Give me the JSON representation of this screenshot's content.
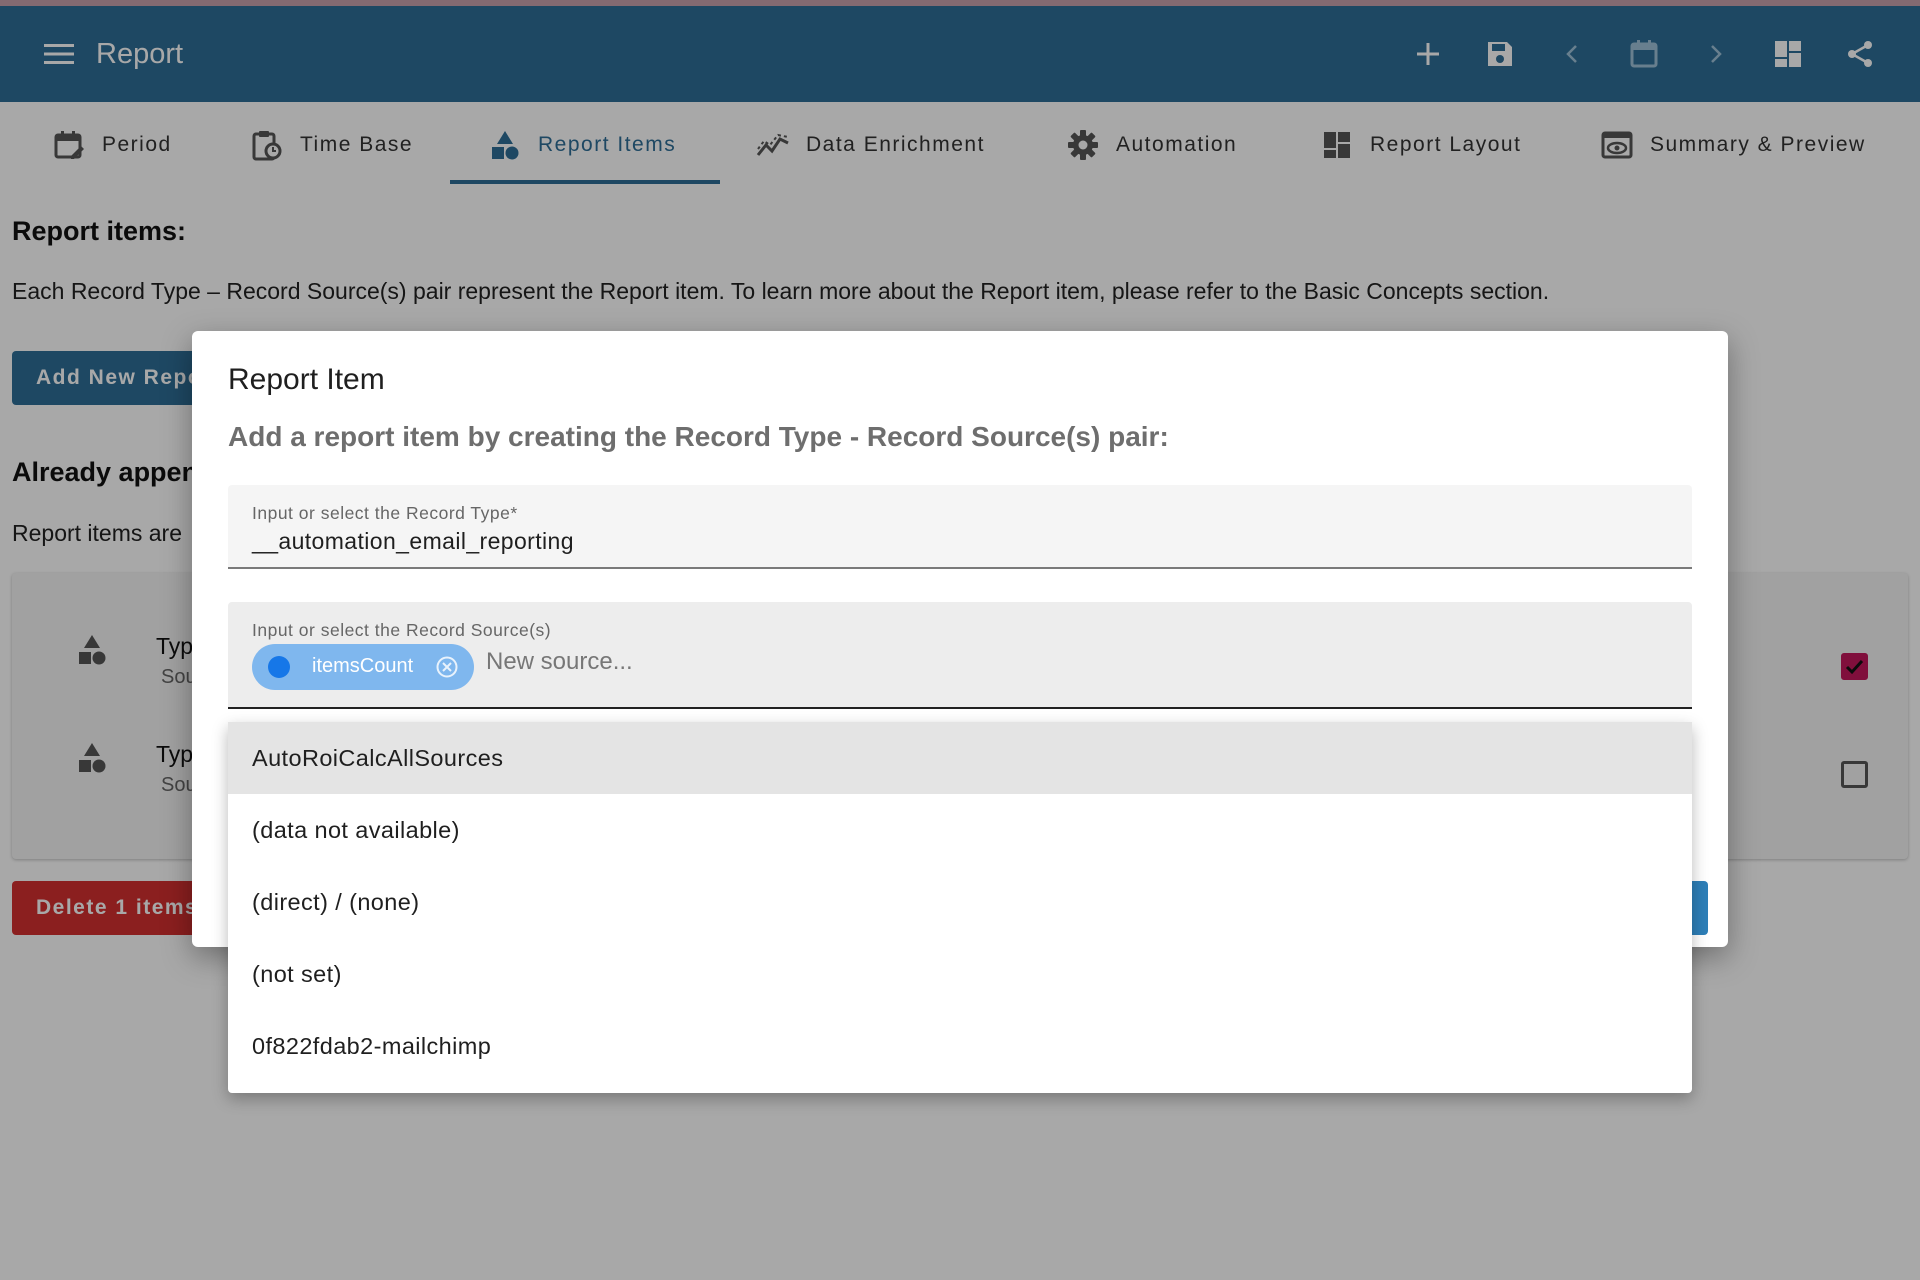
{
  "appbar": {
    "title": "Report",
    "actions": [
      "add-icon",
      "save-icon",
      "chevron-left-icon",
      "calendar-icon",
      "chevron-right-icon",
      "dashboard-icon",
      "share-icon"
    ]
  },
  "tabs": [
    {
      "label": "Period",
      "icon": "calendar-edit-icon"
    },
    {
      "label": "Time Base",
      "icon": "clipboard-clock-icon"
    },
    {
      "label": "Report Items",
      "icon": "shapes-icon",
      "active": true
    },
    {
      "label": "Data Enrichment",
      "icon": "chart-line-icon"
    },
    {
      "label": "Automation",
      "icon": "gear-icon"
    },
    {
      "label": "Report Layout",
      "icon": "dashboard-icon"
    },
    {
      "label": "Summary & Preview",
      "icon": "eye-preview-icon"
    }
  ],
  "content": {
    "heading": "Report items:",
    "description": "Each Record Type – Record Source(s) pair represent the Report item. To learn more about the Report item, please refer to the Basic Concepts section.",
    "add_button": "Add New Repo",
    "appended_heading": "Already appen",
    "appended_text": "Report items are",
    "rows": [
      {
        "type": "Type",
        "source": "Sour",
        "checked": true
      },
      {
        "type": "Type",
        "source": "Sour",
        "checked": false
      }
    ],
    "delete_button": "Delete 1 items"
  },
  "dialog": {
    "title": "Report Item",
    "subtitle": "Add a report item by creating the Record Type - Record Source(s) pair:",
    "record_type": {
      "label": "Input or select the Record Type*",
      "value": "__automation_email_reporting"
    },
    "record_source": {
      "label": "Input or select the Record Source(s)",
      "chips": [
        "itemsCount"
      ],
      "placeholder": "New source..."
    },
    "options": [
      "AutoRoiCalcAllSources",
      "(data not available)",
      "(direct) / (none)",
      "(not set)",
      "0f822fdab2-mailchimp"
    ],
    "highlighted_option": "AutoRoiCalcAllSources"
  },
  "colors": {
    "primary": "#2e6e97",
    "danger": "#d32f2f",
    "checkbox": "#c2185b",
    "chip": "#7fb7ee"
  }
}
